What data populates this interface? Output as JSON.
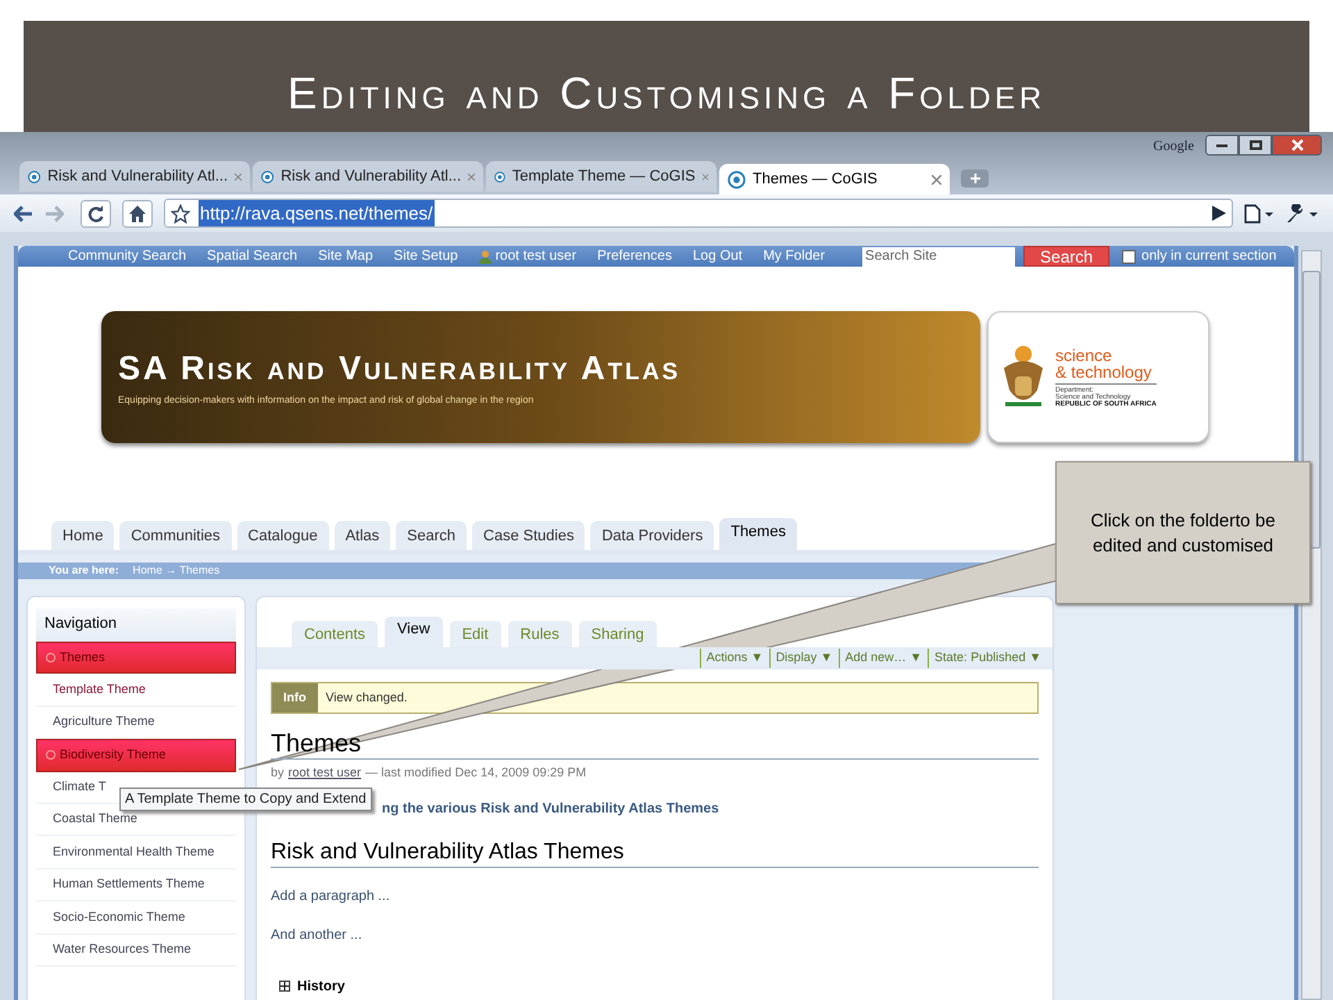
{
  "slide": {
    "title": "Editing and Customising a Folder"
  },
  "browser": {
    "brand": "Google",
    "tabs": [
      {
        "label": "Risk and Vulnerability Atl...",
        "selected": false
      },
      {
        "label": "Risk and Vulnerability Atl...",
        "selected": false
      },
      {
        "label": "Template Theme — CoGIS",
        "selected": false
      },
      {
        "label": "Themes — CoGIS",
        "selected": true
      }
    ],
    "url": "http://rava.qsens.net/themes/"
  },
  "site_nav": {
    "links": [
      "Community Search",
      "Spatial Search",
      "Site Map",
      "Site Setup"
    ],
    "user": "root test user",
    "links_after": [
      "Preferences",
      "Log Out",
      "My Folder"
    ],
    "search": {
      "placeholder": "Search Site",
      "button": "Search"
    },
    "section_checkbox": {
      "label": "only in current section",
      "checked": false
    }
  },
  "banner": {
    "title": "SA Risk and Vulnerability Atlas",
    "subtitle": "Equipping decision-makers with information on the impact and risk of global change in the region",
    "sponsor": {
      "line1": "science",
      "line2": "& technology",
      "department": "Department:",
      "dept_name": "Science and Technology",
      "country": "REPUBLIC OF SOUTH AFRICA"
    }
  },
  "section_tabs": [
    {
      "label": "Home",
      "selected": false
    },
    {
      "label": "Communities",
      "selected": false
    },
    {
      "label": "Catalogue",
      "selected": false
    },
    {
      "label": "Atlas",
      "selected": false
    },
    {
      "label": "Search",
      "selected": false
    },
    {
      "label": "Case Studies",
      "selected": false
    },
    {
      "label": "Data Providers",
      "selected": false
    },
    {
      "label": "Themes",
      "selected": true
    }
  ],
  "breadcrumb": {
    "label": "You are here:",
    "path": "Home → Themes"
  },
  "navigation": {
    "title": "Navigation",
    "items": [
      {
        "label": "Themes",
        "selected": true,
        "visited": false
      },
      {
        "label": "Template Theme",
        "selected": false,
        "visited": true
      },
      {
        "label": "Agriculture Theme",
        "selected": false,
        "visited": false
      },
      {
        "label": "Biodiversity Theme",
        "selected": true,
        "visited": false
      },
      {
        "label": "Climate T",
        "selected": false,
        "visited": false
      },
      {
        "label": "Coastal Theme",
        "selected": false,
        "visited": false
      },
      {
        "label": "Environmental Health Theme",
        "selected": false,
        "visited": false
      },
      {
        "label": "Human Settlements Theme",
        "selected": false,
        "visited": false
      },
      {
        "label": "Socio-Economic Theme",
        "selected": false,
        "visited": false
      },
      {
        "label": "Water Resources Theme",
        "selected": false,
        "visited": false
      }
    ]
  },
  "content_tabs": [
    {
      "label": "Contents",
      "selected": false
    },
    {
      "label": "View",
      "selected": true
    },
    {
      "label": "Edit",
      "selected": false
    },
    {
      "label": "Rules",
      "selected": false
    },
    {
      "label": "Sharing",
      "selected": false
    }
  ],
  "actions": [
    "Actions ▼",
    "Display ▼",
    "Add new… ▼",
    "State: Published ▼"
  ],
  "message": {
    "kind": "info",
    "label": "Info",
    "text": "View changed."
  },
  "heading": "Themes",
  "byline": {
    "prefix": "by",
    "author": "root test user",
    "modified": "— last modified Dec 14, 2009 09:29 PM"
  },
  "description": "ng the various Risk and Vulnerability Atlas Themes",
  "subheading": "Risk and Vulnerability Atlas Themes",
  "paragraphs": [
    "Add a paragraph ...",
    "And another ..."
  ],
  "history": {
    "label": "History",
    "expanded": false
  },
  "tooltip": "A Template Theme to Copy and Extend",
  "callout": "Click on the folderto be edited and customised"
}
